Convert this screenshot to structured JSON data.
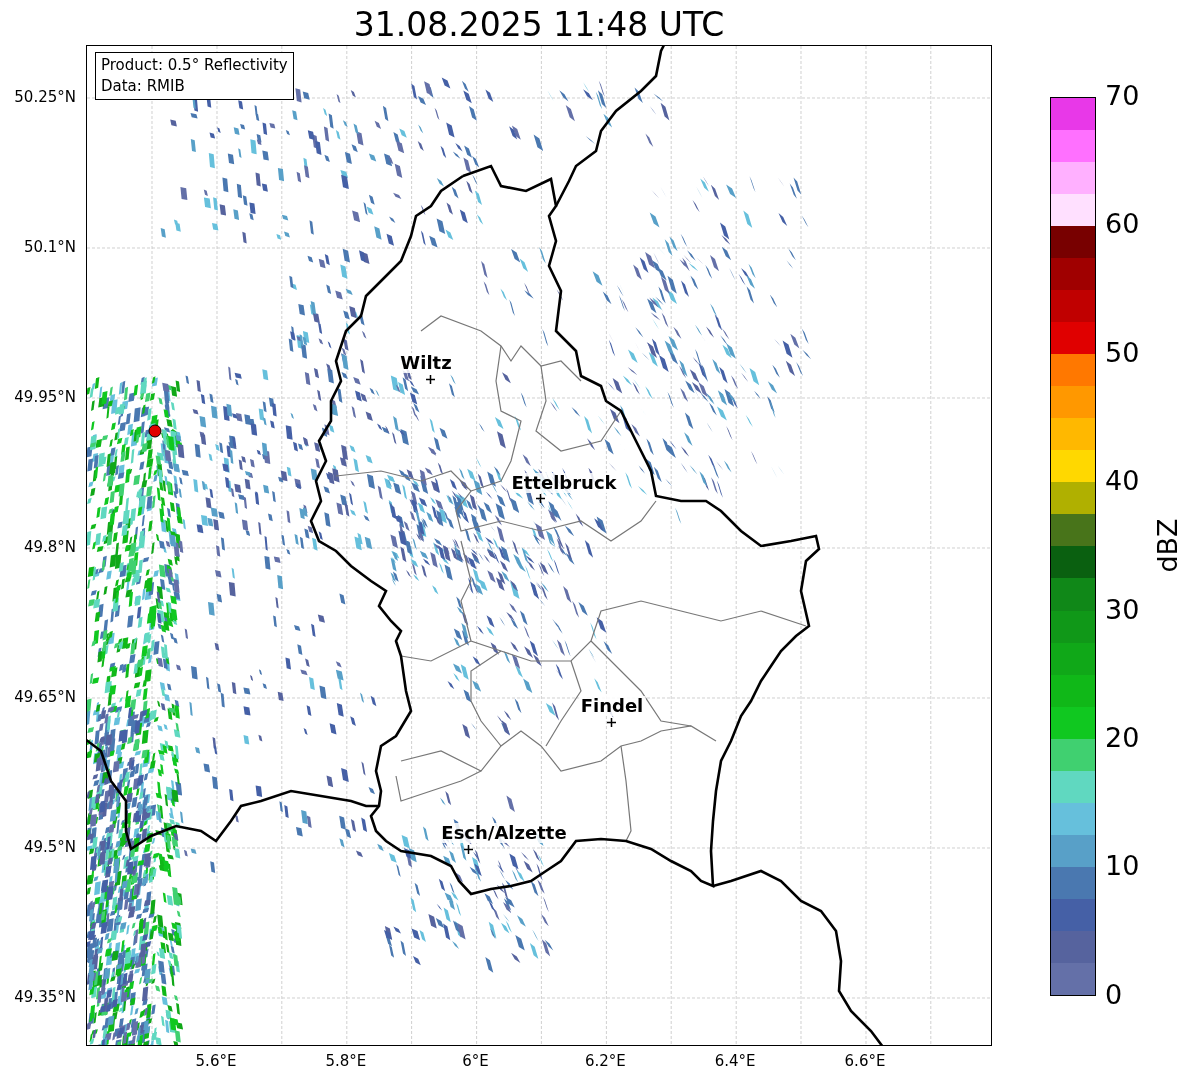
{
  "title": "31.08.2025 11:48 UTC",
  "info_box": [
    "Product: 0.5° Reflectivity",
    "Data: RMIB"
  ],
  "map": {
    "cities": [
      {
        "name": "Wiltz"
      },
      {
        "name": "Ettelbruck"
      },
      {
        "name": "Findel"
      },
      {
        "name": "Esch/Alzette"
      }
    ],
    "y_ticks": [
      "50.25°N",
      "50.1°N",
      "49.95°N",
      "49.8°N",
      "49.65°N",
      "49.5°N",
      "49.35°N"
    ],
    "x_ticks": [
      "5.6°E",
      "5.8°E",
      "6°E",
      "6.2°E",
      "6.4°E",
      "6.6°E"
    ]
  },
  "colorbar": {
    "label": "dBZ",
    "ticks": [
      "70",
      "60",
      "50",
      "40",
      "30",
      "20",
      "10",
      "0"
    ],
    "segments": [
      {
        "color": "#e838e8"
      },
      {
        "color": "#ff70ff"
      },
      {
        "color": "#ffb0ff"
      },
      {
        "color": "#ffe0ff"
      },
      {
        "color": "#780000"
      },
      {
        "color": "#a00000"
      },
      {
        "color": "#c00000"
      },
      {
        "color": "#e00000"
      },
      {
        "color": "#ff7800"
      },
      {
        "color": "#ff9800"
      },
      {
        "color": "#ffb800"
      },
      {
        "color": "#ffd800"
      },
      {
        "color": "#b0b000"
      },
      {
        "color": "#48741a"
      },
      {
        "color": "#0a6010"
      },
      {
        "color": "#108818"
      },
      {
        "color": "#109818"
      },
      {
        "color": "#10a818"
      },
      {
        "color": "#10b818"
      },
      {
        "color": "#10c820"
      },
      {
        "color": "#40d070"
      },
      {
        "color": "#60d8c0"
      },
      {
        "color": "#66c0dc"
      },
      {
        "color": "#58a0c8"
      },
      {
        "color": "#4a78b0"
      },
      {
        "color": "#4560a6"
      },
      {
        "color": "#56639e"
      },
      {
        "color": "#6470a8"
      }
    ]
  }
}
